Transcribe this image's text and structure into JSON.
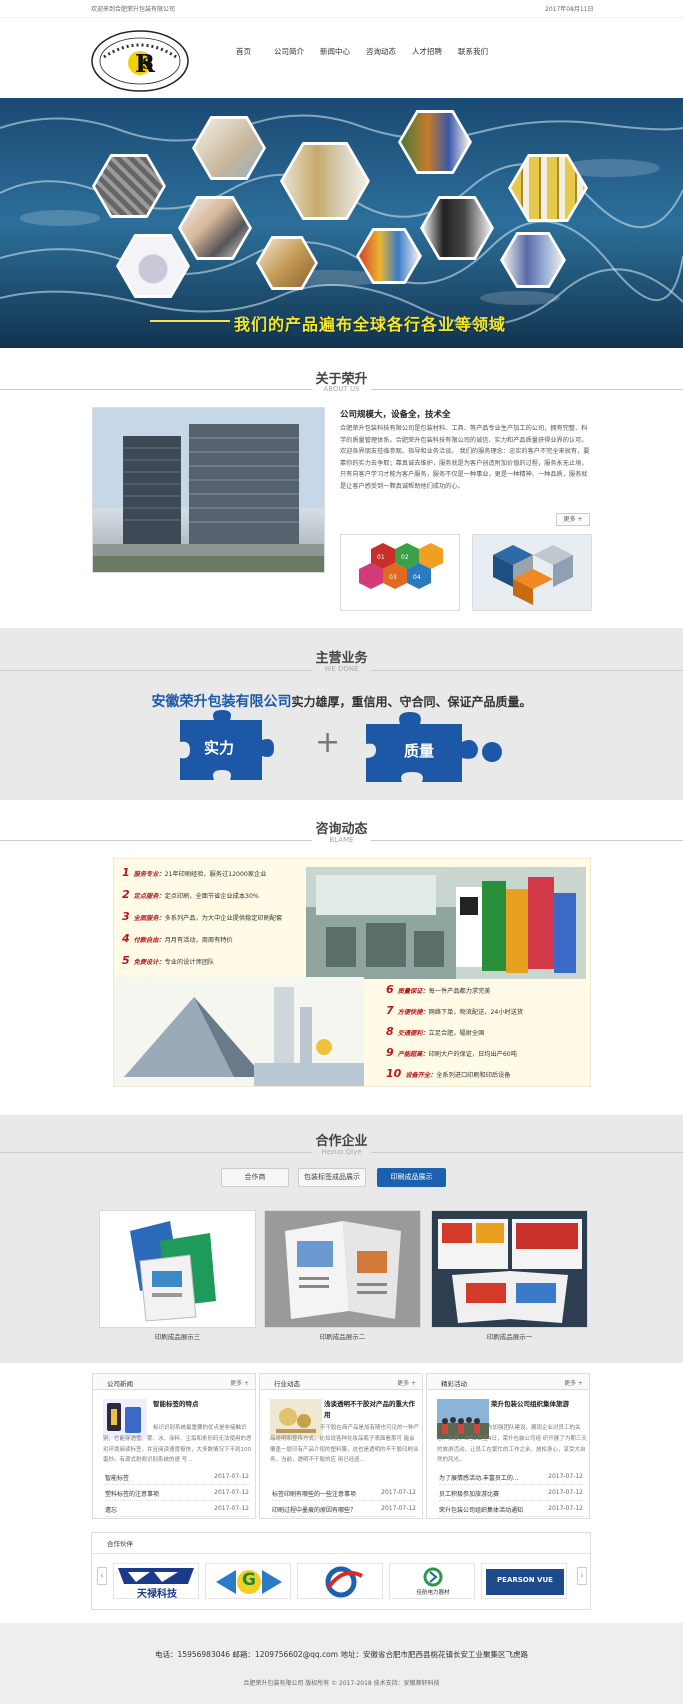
{
  "topbar": {
    "welcome": "欢迎来到合肥荣升包装有限公司",
    "date": "2017年08月11日"
  },
  "nav": [
    "首页",
    "公司简介",
    "新闻中心",
    "咨询动态",
    "人才招聘",
    "联系我们"
  ],
  "banner": {
    "slogan": "我们的产品遍布全球各行各业等领域"
  },
  "about": {
    "title": "关于荣升",
    "subtitle": "ABOUT US",
    "heading": "公司规模大，设备全，技术全",
    "text": "合肥荣升包装科技有限公司是包装材料、工具、等产品专业生产加工的公司，拥有完整、科学的质量管理体系。合肥荣升包装科技有限公司的诚信、实力和产品质量获得业界的认可。欢迎各界朋友莅临参观、指导和业务洽谈。 我们的服务理念：忠实的客户不完全来就有，要靠你的实力去争取；靠真诚去维护，服务就是为客户创造附加价值的过程，服务永无止境，只有向客户学习才能为客户服务，服务不仅是一种事业，更是一种精神、一种品质，服务就是让客户感受到一颗真诚帮助他们成功的心。",
    "more": "更多 +"
  },
  "business": {
    "title": "主营业务",
    "subtitle": "WE DONE",
    "company": "安徽荣升包装有限公司",
    "slogan": "实力雄厚，重信用、守合同、保证产品质量。",
    "piece1": "实力",
    "plus": "+",
    "piece2": "质量"
  },
  "consult": {
    "title": "咨询动态",
    "subtitle": "BLAME",
    "left_items": [
      {
        "num": "1",
        "label": "服务专业：",
        "text": "21年印刷经验，服务过12000家企业"
      },
      {
        "num": "2",
        "label": "定点服务：",
        "text": "定点印刷，全面节省企业成本30%"
      },
      {
        "num": "3",
        "label": "全面服务：",
        "text": "多系列产品，为大中企业提供稳定印刷配套"
      },
      {
        "num": "4",
        "label": "付款自由：",
        "text": "月月有活动，周周有特价"
      },
      {
        "num": "5",
        "label": "免费设计：",
        "text": "专业的设计师团队"
      }
    ],
    "right_items": [
      {
        "num": "6",
        "label": "质量保证：",
        "text": "每一件产品都力求完美"
      },
      {
        "num": "7",
        "label": "方便快捷：",
        "text": "网络下单，物流配送，24小时送货"
      },
      {
        "num": "8",
        "label": "交通便利：",
        "text": "立足合肥，辐射全国"
      },
      {
        "num": "9",
        "label": "产能超高：",
        "text": "印刷大户的保证，日均出产60吨"
      },
      {
        "num": "10",
        "label": "设备齐全：",
        "text": "全系列进口印刷和印后设备"
      }
    ]
  },
  "partners": {
    "title": "合作企业",
    "subtitle": "Hezuo Qiye",
    "tabs": [
      "合作商",
      "包装标签成品展示",
      "印刷成品展示"
    ],
    "cards": [
      "印刷成品展示三",
      "印刷成品展示二",
      "印刷成品展示一"
    ]
  },
  "news": [
    {
      "title": "公司新闻",
      "more": "更多 +",
      "feature_title": "智能标签的特点",
      "feature_desc": "标识识别系统最重要的优点是非接触识别，它能穿透雪、雾、冰、涂料、尘垢和条形码无法使用的恶劣环境阅读标签，并且阅读速度极快，大多数情况下不到100毫秒。有源式射频识别系统的速 写...",
      "rows": [
        {
          "name": "智能标签",
          "date": "2017-07-12"
        },
        {
          "name": "塑料标签的注意事项",
          "date": "2017-07-12"
        },
        {
          "name": "遗忘",
          "date": "2017-07-12"
        }
      ]
    },
    {
      "title": "行业动态",
      "more": "更多 +",
      "feature_title": "浅谈透明不干胶对产品的重大作用",
      "feature_desc": "不干胶在商产品是加有随也可见的一种产品说明和宣传方式，比如说各种化妆品瓶子表面看那可 能会覆盖一层印有产品介绍的塑料膜，这也是透明的不干胶印刷业务，当前，透明不干胶的应 用已经逐...",
      "rows": [
        {
          "name": "标签印刷有哪些的一些注意事项",
          "date": "2017-07-12"
        },
        {
          "name": "印刷过程中墨痕的原因有哪些？",
          "date": "2017-07-12"
        }
      ]
    },
    {
      "title": "精彩活动",
      "more": "更多 +",
      "feature_title": "荣升包装公司组织集体旅游",
      "feature_desc": "为加强团队建设，展现企业对员工的关心、关爱，9月2日至4日，荣升包装公司组 织开展了为期三天的旅游活动，让员工在繁忙的工作之余，放松身心，享受大自然的风光。",
      "rows": [
        {
          "name": "为了展情感活动,丰富员工的...",
          "date": "2017-07-12"
        },
        {
          "name": "员工积极参加旅游比赛",
          "date": "2017-07-12"
        },
        {
          "name": "荣升包装公司组织集体活动通知",
          "date": "2017-07-12"
        }
      ]
    }
  ],
  "logos": {
    "title": "合作伙伴",
    "prev": "‹",
    "next": "›",
    "items": [
      "天禄科技",
      "G",
      "",
      "佳航电力器材",
      "PEARSON VUE"
    ]
  },
  "footer": {
    "contact": "电话：15956983046  邮箱：1209756602@qq.com  地址：安徽省合肥市肥西县桃花镇长安工业聚集区飞虎路",
    "copyright": "合肥荣升包装有限公司 版权所有 © 2017-2018 技术支持：安徽顺轩科技"
  },
  "colors": {
    "accent_blue": "#1c61ad",
    "highlight_red": "#b5171b",
    "banner_yellow": "#f7e52a"
  }
}
